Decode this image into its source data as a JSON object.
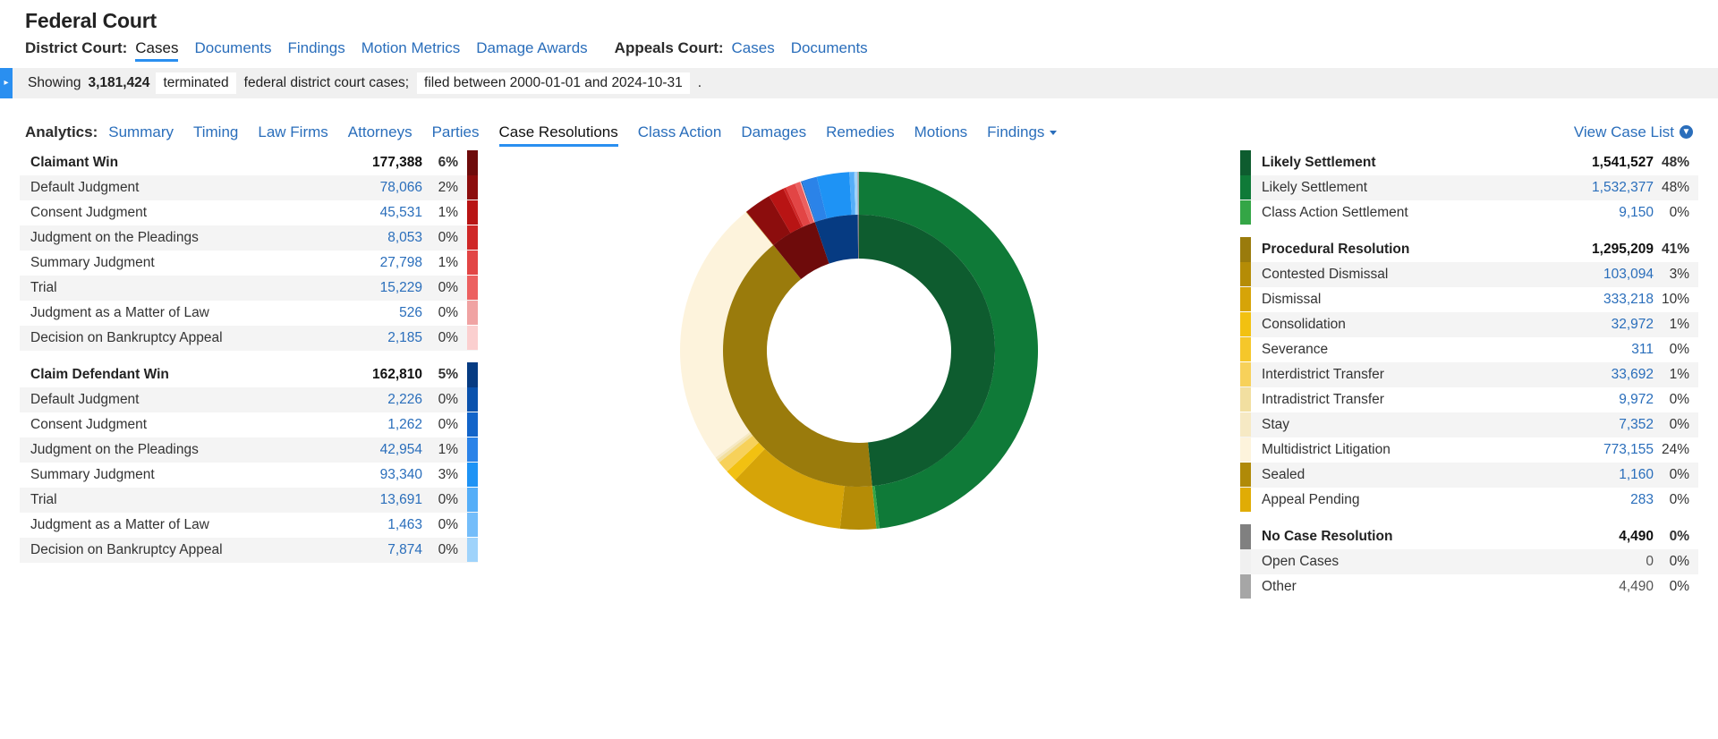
{
  "header": {
    "title": "Federal Court",
    "district_label": "District Court:",
    "district_links": [
      {
        "label": "Cases",
        "active": true
      },
      {
        "label": "Documents",
        "active": false
      },
      {
        "label": "Findings",
        "active": false
      },
      {
        "label": "Motion Metrics",
        "active": false
      },
      {
        "label": "Damage Awards",
        "active": false
      }
    ],
    "appeals_label": "Appeals Court:",
    "appeals_links": [
      {
        "label": "Cases",
        "active": false
      },
      {
        "label": "Documents",
        "active": false
      }
    ]
  },
  "info_bar": {
    "toggle_icon": "chevron-right-icon",
    "prefix": "Showing",
    "count": "3,181,424",
    "status_chip": "terminated",
    "middle": "federal district court cases;",
    "filed_chip": "filed between 2000-01-01 and 2024-10-31",
    "suffix": "."
  },
  "analytics": {
    "label": "Analytics:",
    "tabs": [
      {
        "label": "Summary",
        "active": false,
        "caret": false
      },
      {
        "label": "Timing",
        "active": false,
        "caret": false
      },
      {
        "label": "Law Firms",
        "active": false,
        "caret": false
      },
      {
        "label": "Attorneys",
        "active": false,
        "caret": false
      },
      {
        "label": "Parties",
        "active": false,
        "caret": false
      },
      {
        "label": "Case Resolutions",
        "active": true,
        "caret": false
      },
      {
        "label": "Class Action",
        "active": false,
        "caret": false
      },
      {
        "label": "Damages",
        "active": false,
        "caret": false
      },
      {
        "label": "Remedies",
        "active": false,
        "caret": false
      },
      {
        "label": "Motions",
        "active": false,
        "caret": false
      },
      {
        "label": "Findings",
        "active": false,
        "caret": true
      }
    ],
    "view_case_list": "View Case List",
    "view_case_list_icon": "download-circle-icon"
  },
  "left_table": [
    {
      "type": "group",
      "label": "Claimant Win",
      "value": "177,388",
      "pct": "6%",
      "color": "#6e0b0b"
    },
    {
      "type": "row",
      "label": "Default Judgment",
      "value": "78,066",
      "pct": "2%",
      "color": "#8c0d0d"
    },
    {
      "type": "row",
      "label": "Consent Judgment",
      "value": "45,531",
      "pct": "1%",
      "color": "#b81414"
    },
    {
      "type": "row",
      "label": "Judgment on the Pleadings",
      "value": "8,053",
      "pct": "0%",
      "color": "#cf2727"
    },
    {
      "type": "row",
      "label": "Summary Judgment",
      "value": "27,798",
      "pct": "1%",
      "color": "#e24545"
    },
    {
      "type": "row",
      "label": "Trial",
      "value": "15,229",
      "pct": "0%",
      "color": "#ec6060"
    },
    {
      "type": "row",
      "label": "Judgment as a Matter of Law",
      "value": "526",
      "pct": "0%",
      "color": "#f0a3a3"
    },
    {
      "type": "row",
      "label": "Decision on Bankruptcy Appeal",
      "value": "2,185",
      "pct": "0%",
      "color": "#fbcfcf"
    },
    {
      "type": "spacer"
    },
    {
      "type": "group",
      "label": "Claim Defendant Win",
      "value": "162,810",
      "pct": "5%",
      "color": "#063b82"
    },
    {
      "type": "row",
      "label": "Default Judgment",
      "value": "2,226",
      "pct": "0%",
      "color": "#0a52ad"
    },
    {
      "type": "row",
      "label": "Consent Judgment",
      "value": "1,262",
      "pct": "0%",
      "color": "#1264c9"
    },
    {
      "type": "row",
      "label": "Judgment on the Pleadings",
      "value": "42,954",
      "pct": "1%",
      "color": "#2b83e8"
    },
    {
      "type": "row",
      "label": "Summary Judgment",
      "value": "93,340",
      "pct": "3%",
      "color": "#1e93f5"
    },
    {
      "type": "row",
      "label": "Trial",
      "value": "13,691",
      "pct": "0%",
      "color": "#55aef8"
    },
    {
      "type": "row",
      "label": "Judgment as a Matter of Law",
      "value": "1,463",
      "pct": "0%",
      "color": "#74bdfa"
    },
    {
      "type": "row",
      "label": "Decision on Bankruptcy Appeal",
      "value": "7,874",
      "pct": "0%",
      "color": "#9fd3fb"
    }
  ],
  "right_table": [
    {
      "type": "group",
      "label": "Likely Settlement",
      "value": "1,541,527",
      "pct": "48%",
      "color": "#0e5c2f"
    },
    {
      "type": "row",
      "label": "Likely Settlement",
      "value": "1,532,377",
      "pct": "48%",
      "color": "#0f7a38"
    },
    {
      "type": "row",
      "label": "Class Action Settlement",
      "value": "9,150",
      "pct": "0%",
      "color": "#34a646"
    },
    {
      "type": "spacer"
    },
    {
      "type": "group",
      "label": "Procedural Resolution",
      "value": "1,295,209",
      "pct": "41%",
      "color": "#9a7b0c"
    },
    {
      "type": "row",
      "label": "Contested Dismissal",
      "value": "103,094",
      "pct": "3%",
      "color": "#b58c06"
    },
    {
      "type": "row",
      "label": "Dismissal",
      "value": "333,218",
      "pct": "10%",
      "color": "#d6a408"
    },
    {
      "type": "row",
      "label": "Consolidation",
      "value": "32,972",
      "pct": "1%",
      "color": "#f2c111"
    },
    {
      "type": "row",
      "label": "Severance",
      "value": "311",
      "pct": "0%",
      "color": "#f5c72a"
    },
    {
      "type": "row",
      "label": "Interdistrict Transfer",
      "value": "33,692",
      "pct": "1%",
      "color": "#f7d15a"
    },
    {
      "type": "row",
      "label": "Intradistrict Transfer",
      "value": "9,972",
      "pct": "0%",
      "color": "#f2dfa0"
    },
    {
      "type": "row",
      "label": "Stay",
      "value": "7,352",
      "pct": "0%",
      "color": "#f6e9c4"
    },
    {
      "type": "row",
      "label": "Multidistrict Litigation",
      "value": "773,155",
      "pct": "24%",
      "color": "#fdf3dc"
    },
    {
      "type": "row",
      "label": "Sealed",
      "value": "1,160",
      "pct": "0%",
      "color": "#b08a08"
    },
    {
      "type": "row",
      "label": "Appeal Pending",
      "value": "283",
      "pct": "0%",
      "color": "#e0ac05"
    },
    {
      "type": "spacer"
    },
    {
      "type": "group",
      "label": "No Case Resolution",
      "value": "4,490",
      "pct": "0%",
      "color": "#808080"
    },
    {
      "type": "row",
      "label": "Open Cases",
      "value": "0",
      "pct": "0%",
      "color": "#f0f0f0",
      "plain": true
    },
    {
      "type": "row",
      "label": "Other",
      "value": "4,490",
      "pct": "0%",
      "color": "#a6a6a6",
      "plain": true
    }
  ],
  "chart_data": {
    "type": "pie",
    "title": "",
    "variant": "sunburst-donut",
    "total": 3181424,
    "inner_ring": [
      {
        "name": "Likely Settlement",
        "value": 1541527,
        "pct": 48,
        "color": "#0e5c2f"
      },
      {
        "name": "Procedural Resolution",
        "value": 1295209,
        "pct": 41,
        "color": "#9a7b0c"
      },
      {
        "name": "Claimant Win",
        "value": 177388,
        "pct": 6,
        "color": "#6e0b0b"
      },
      {
        "name": "Claim Defendant Win",
        "value": 162810,
        "pct": 5,
        "color": "#063b82"
      },
      {
        "name": "No Case Resolution",
        "value": 4490,
        "pct": 0,
        "color": "#808080"
      }
    ],
    "outer_ring": [
      {
        "name": "Likely Settlement",
        "value": 1532377,
        "pct": 48,
        "color": "#0f7a38"
      },
      {
        "name": "Class Action Settlement",
        "value": 9150,
        "pct": 0,
        "color": "#34a646"
      },
      {
        "name": "Contested Dismissal",
        "value": 103094,
        "pct": 3,
        "color": "#b58c06"
      },
      {
        "name": "Dismissal",
        "value": 333218,
        "pct": 10,
        "color": "#d6a408"
      },
      {
        "name": "Consolidation",
        "value": 32972,
        "pct": 1,
        "color": "#f2c111"
      },
      {
        "name": "Severance",
        "value": 311,
        "pct": 0,
        "color": "#f5c72a"
      },
      {
        "name": "Interdistrict Transfer",
        "value": 33692,
        "pct": 1,
        "color": "#f7d15a"
      },
      {
        "name": "Intradistrict Transfer",
        "value": 9972,
        "pct": 0,
        "color": "#f2dfa0"
      },
      {
        "name": "Stay",
        "value": 7352,
        "pct": 0,
        "color": "#f6e9c4"
      },
      {
        "name": "Multidistrict Litigation",
        "value": 773155,
        "pct": 24,
        "color": "#fdf3dc"
      },
      {
        "name": "Sealed",
        "value": 1160,
        "pct": 0,
        "color": "#b08a08"
      },
      {
        "name": "Appeal Pending",
        "value": 283,
        "pct": 0,
        "color": "#e0ac05"
      },
      {
        "name": "Default Judgment (Claimant)",
        "value": 78066,
        "pct": 2,
        "color": "#8c0d0d"
      },
      {
        "name": "Consent Judgment (Claimant)",
        "value": 45531,
        "pct": 1,
        "color": "#b81414"
      },
      {
        "name": "Judgment on the Pleadings (Claimant)",
        "value": 8053,
        "pct": 0,
        "color": "#cf2727"
      },
      {
        "name": "Summary Judgment (Claimant)",
        "value": 27798,
        "pct": 1,
        "color": "#e24545"
      },
      {
        "name": "Trial (Claimant)",
        "value": 15229,
        "pct": 0,
        "color": "#ec6060"
      },
      {
        "name": "Judgment as a Matter of Law (Claimant)",
        "value": 526,
        "pct": 0,
        "color": "#f0a3a3"
      },
      {
        "name": "Decision on Bankruptcy Appeal (Claimant)",
        "value": 2185,
        "pct": 0,
        "color": "#fbcfcf"
      },
      {
        "name": "Default Judgment (Defendant)",
        "value": 2226,
        "pct": 0,
        "color": "#0a52ad"
      },
      {
        "name": "Consent Judgment (Defendant)",
        "value": 1262,
        "pct": 0,
        "color": "#1264c9"
      },
      {
        "name": "Judgment on the Pleadings (Defendant)",
        "value": 42954,
        "pct": 1,
        "color": "#2b83e8"
      },
      {
        "name": "Summary Judgment (Defendant)",
        "value": 93340,
        "pct": 3,
        "color": "#1e93f5"
      },
      {
        "name": "Trial (Defendant)",
        "value": 13691,
        "pct": 0,
        "color": "#55aef8"
      },
      {
        "name": "Judgment as a Matter of Law (Defendant)",
        "value": 1463,
        "pct": 0,
        "color": "#74bdfa"
      },
      {
        "name": "Decision on Bankruptcy Appeal (Defendant)",
        "value": 7874,
        "pct": 0,
        "color": "#9fd3fb"
      },
      {
        "name": "Open Cases",
        "value": 0,
        "pct": 0,
        "color": "#d0d0d0"
      },
      {
        "name": "Other",
        "value": 4490,
        "pct": 0,
        "color": "#a6a6a6"
      }
    ],
    "legend_position": "left-and-right-tables",
    "grid": false
  }
}
